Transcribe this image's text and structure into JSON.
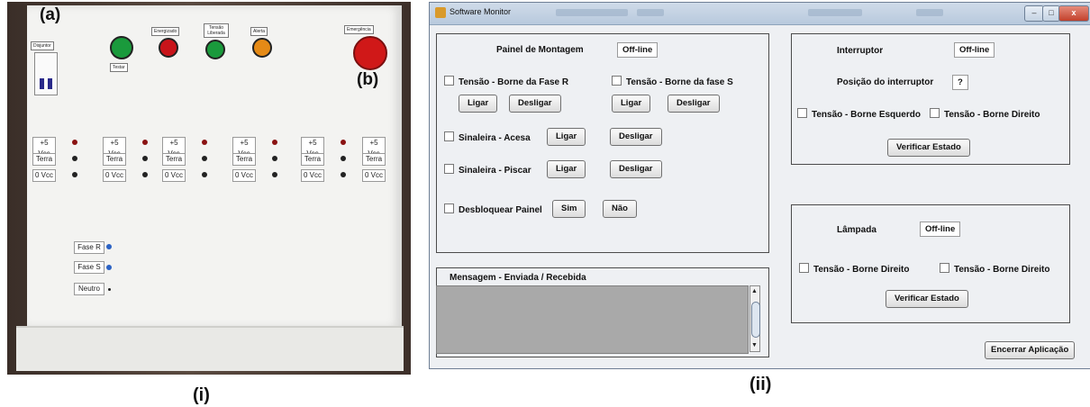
{
  "figure": {
    "caption_left": "(i)",
    "caption_right": "(ii)"
  },
  "photo": {
    "label_a": "(a)",
    "label_b": "(b)",
    "breaker_label": "Disjuntor",
    "testar_label": "Testar",
    "indicators": [
      "Energizado",
      "Tensão Liberada",
      "Alerta"
    ],
    "emergency_label": "Emergência",
    "terminal_blocks": [
      "+5 Vcc",
      "Terra",
      "0 Vcc"
    ],
    "phase_labels": [
      "Fase R",
      "Fase S",
      "Neutro"
    ],
    "colors": {
      "red": "#c8141a",
      "green": "#1a9a3c",
      "orange": "#e58a16",
      "blue": "#2b62c4"
    }
  },
  "window": {
    "title": "Software Monitor",
    "controls": {
      "minimize": "–",
      "maximize": "□",
      "close": "x"
    },
    "painel": {
      "title": "Painel de Montagem",
      "status": "Off-line",
      "check_fase_r": "Tensão - Borne da Fase R",
      "check_fase_s": "Tensão - Borne da fase S",
      "ligar": "Ligar",
      "desligar": "Desligar",
      "sinaleira_acesa": "Sinaleira  - Acesa",
      "sinaleira_piscar": "Sinaleira - Piscar",
      "desbloquear": "Desbloquear Painel",
      "sim": "Sim",
      "nao": "Não"
    },
    "mensagem": {
      "title": "Mensagem - Enviada / Recebida",
      "value": ""
    },
    "interruptor": {
      "title": "Interruptor",
      "status": "Off-line",
      "posicao_label": "Posição do interruptor",
      "posicao_value": "?",
      "check_esquerdo": "Tensão - Borne Esquerdo",
      "check_direito": "Tensão - Borne Direito",
      "verificar": "Verificar Estado"
    },
    "lampada": {
      "title": "Lâmpada",
      "status": "Off-line",
      "check_1": "Tensão - Borne Direito",
      "check_2": "Tensão - Borne Direito",
      "verificar": "Verificar Estado"
    },
    "encerrar": "Encerrar Aplicação"
  }
}
